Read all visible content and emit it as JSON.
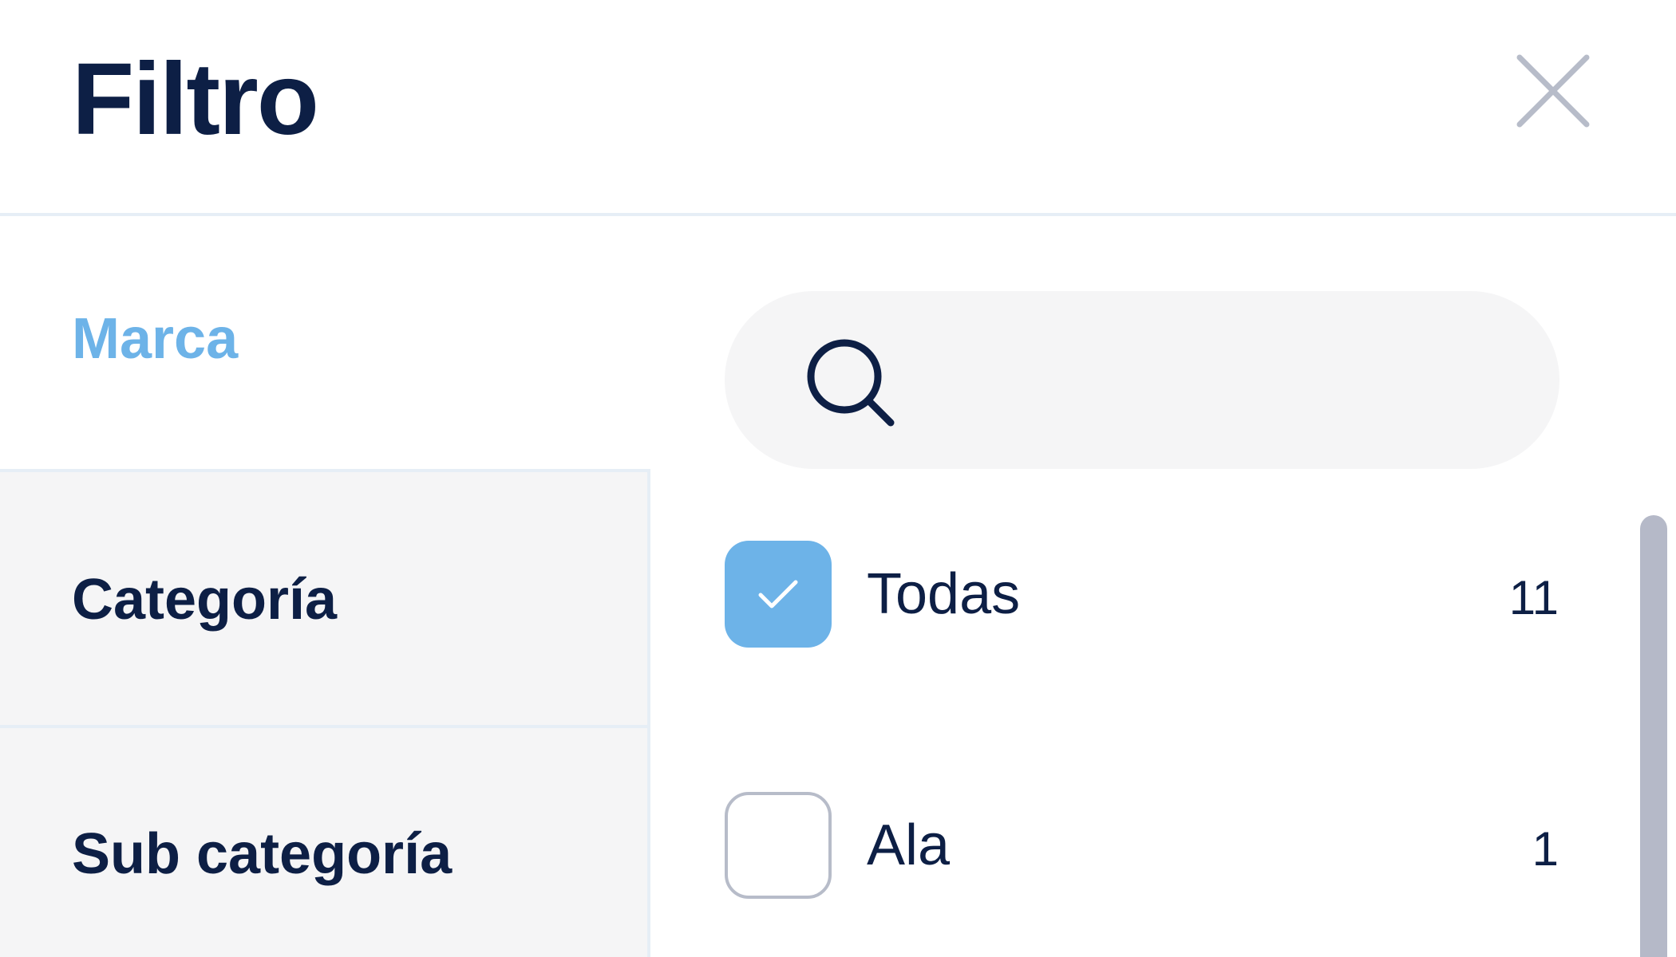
{
  "header": {
    "title": "Filtro"
  },
  "nav": {
    "active_label": "Marca",
    "items": [
      {
        "label": "Categoría"
      },
      {
        "label": "Sub categoría"
      }
    ]
  },
  "search": {
    "value": "",
    "placeholder": ""
  },
  "options": [
    {
      "label": "Todas",
      "count": "11",
      "checked": true
    },
    {
      "label": "Ala",
      "count": "1",
      "checked": false
    }
  ],
  "colors": {
    "primary_text": "#0d1f45",
    "accent": "#6db3e8",
    "panel_bg": "#f5f5f6",
    "divider": "#e6eef6",
    "muted": "#b7bcc9"
  },
  "icons": {
    "close": "close-icon",
    "search": "search-icon",
    "check": "check-icon"
  }
}
